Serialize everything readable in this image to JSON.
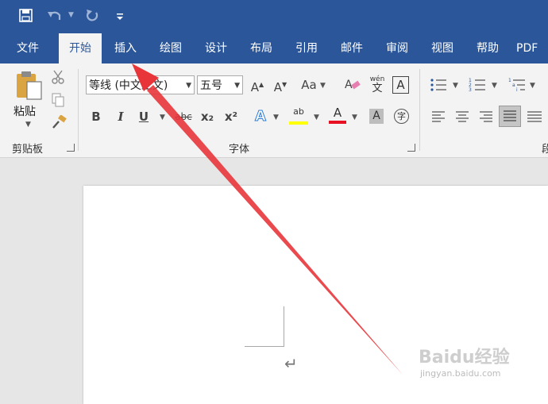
{
  "quick_access": {
    "save_icon": "save-icon",
    "undo_icon": "undo-icon",
    "redo_icon": "redo-icon",
    "customize_icon": "customize-qat-icon"
  },
  "tabs": [
    "文件",
    "开始",
    "插入",
    "绘图",
    "设计",
    "布局",
    "引用",
    "邮件",
    "审阅",
    "视图",
    "帮助",
    "PDF工"
  ],
  "active_tab": "开始",
  "clipboard": {
    "paste_label": "粘贴",
    "group_label": "剪贴板"
  },
  "font": {
    "font_name": "等线 (中文正文)",
    "font_size": "五号",
    "group_label": "字体",
    "change_case": "Aa",
    "phonetic_top": "wén",
    "phonetic_bottom": "文",
    "char_border": "A",
    "bold": "B",
    "italic": "I",
    "underline": "U",
    "strike": "abc",
    "subscript": "x₂",
    "superscript": "x²",
    "text_effects": "A",
    "highlight": "ab",
    "font_color": "A",
    "shading": "A",
    "enclose": "字"
  },
  "paragraph": {
    "group_label": "段"
  },
  "colors": {
    "accent": "#2b579a",
    "arrow": "#e8353a",
    "highlight": "#ffff00",
    "font_color": "#e81123"
  },
  "document": {
    "return_mark": "↵"
  },
  "watermark": {
    "brand": "Baidu经验",
    "url": "jingyan.baidu.com"
  }
}
